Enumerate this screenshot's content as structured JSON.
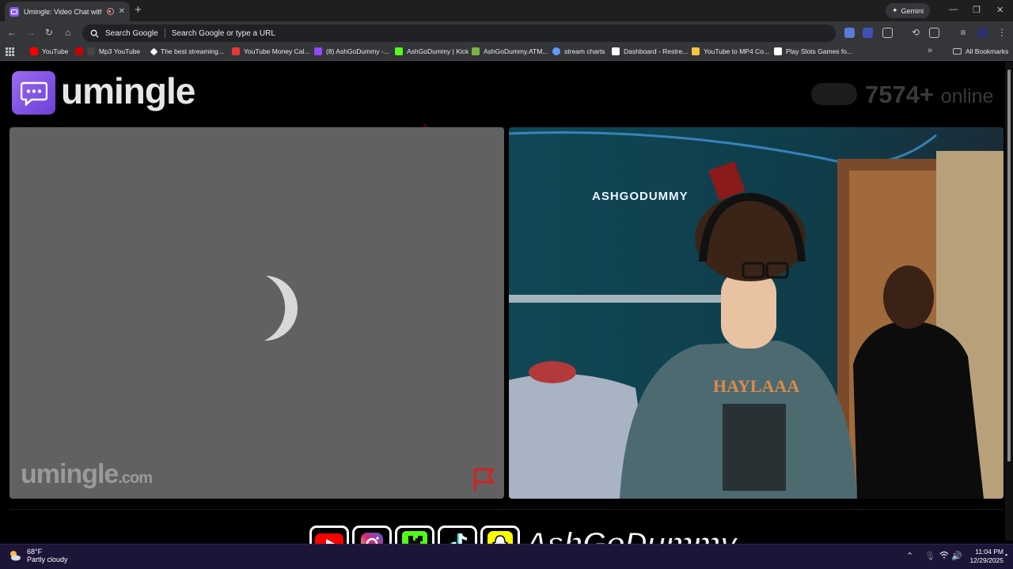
{
  "browser": {
    "tab_title": "Umingle: Video Chat with S",
    "gemini_label": "Gemini",
    "omnibox_prefix": "Search Google",
    "omnibox_placeholder": "Search Google or type a URL",
    "bookmarks": [
      {
        "label": "YouTube",
        "color": "#ff0000"
      },
      {
        "label": "Mp3 YouTube",
        "color": "#cc0000"
      },
      {
        "label": "The best streaming...",
        "color": "#ffffff"
      },
      {
        "label": "YouTube Money Cal...",
        "color": "#e53935"
      },
      {
        "label": "(8) AshGoDummy -...",
        "color": "#9146ff"
      },
      {
        "label": "AshGoDummy | Kick",
        "color": "#53fc18"
      },
      {
        "label": "AshGoDummy.ATM...",
        "color": "#7cb342"
      },
      {
        "label": "stream charts",
        "color": "#5c9cff"
      },
      {
        "label": "Dashboard - Restre...",
        "color": "#ffffff"
      },
      {
        "label": "YouTube to MP4 Co...",
        "color": "#f5c542"
      },
      {
        "label": "Play Slots Games fo...",
        "color": "#ffffff"
      }
    ],
    "all_bookmarks": "All Bookmarks"
  },
  "site": {
    "logo": "umingle",
    "online_count": "7574+",
    "online_label": "online",
    "watermark_name": "umingle",
    "watermark_domain": ".com"
  },
  "overlay": {
    "brand": "AshGoDummy",
    "sign_text": "ASHGODUMMY"
  },
  "taskbar": {
    "temp": "68°F",
    "condition": "Partly cloudy",
    "time": "11:04 PM",
    "date": "12/29/2025"
  },
  "colors": {
    "accent": "#8b5cf6",
    "chrome_bg": "#35363a"
  }
}
